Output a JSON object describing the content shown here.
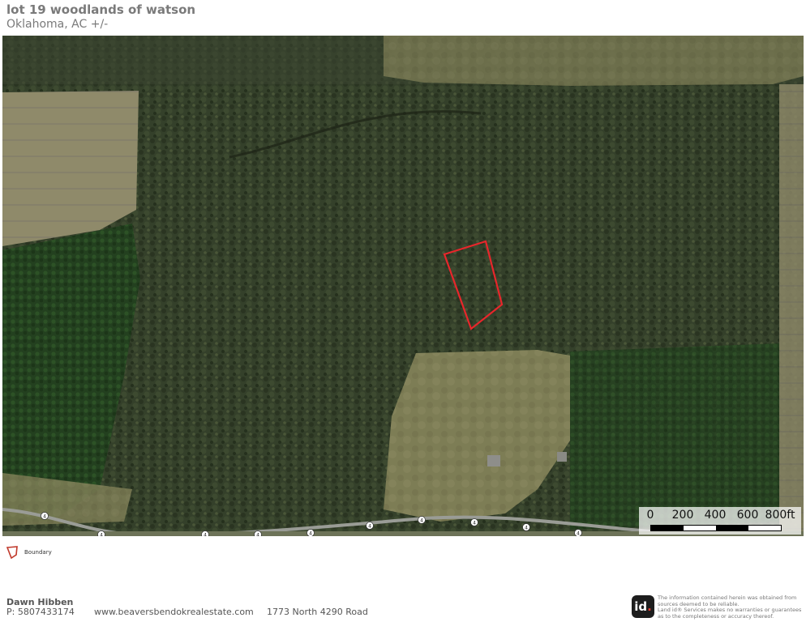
{
  "header": {
    "title": "lot 19 woodlands of watson",
    "subtitle": "Oklahoma,  AC +/-"
  },
  "map": {
    "imagery": "aerial-satellite",
    "boundary_color": "#e8262b",
    "road_marker_label": "4",
    "scale_bar": {
      "labels": [
        "0",
        "200",
        "400",
        "600",
        "800ft"
      ]
    }
  },
  "legend": {
    "items": [
      {
        "icon": "boundary-polygon-icon",
        "label": "Boundary",
        "color": "#c0392b"
      }
    ]
  },
  "footer": {
    "agent_name": "Dawn Hibben",
    "phone": "P: 5807433174",
    "website": "www.beaversbendokrealestate.com",
    "address": "1773 North 4290 Road",
    "logo_text": "id",
    "logo_dot": ".",
    "disclaimer_lines": [
      "The information contained herein was obtained from",
      "sources deemed to be reliable.",
      "Land id® Services makes no warranties or guarantees",
      "as to the completeness or accuracy thereof."
    ]
  }
}
